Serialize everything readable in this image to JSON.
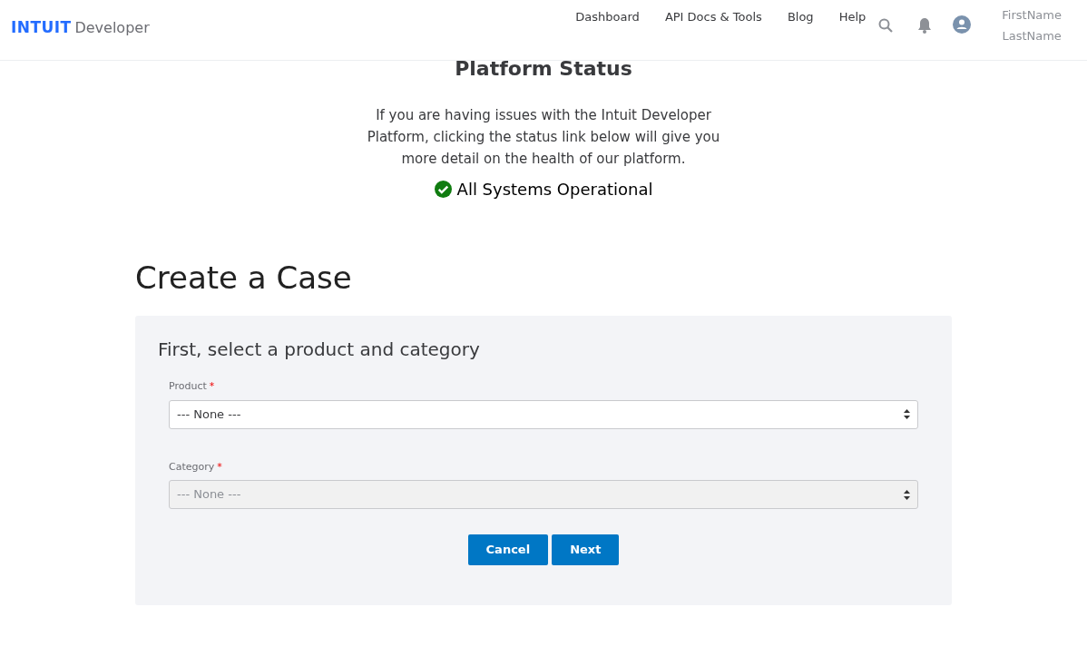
{
  "header": {
    "logo_mark": "INTUIT",
    "logo_text": "Developer",
    "nav": [
      "Dashboard",
      "API Docs & Tools",
      "Blog",
      "Help"
    ],
    "user": {
      "first": "FirstName",
      "last": "LastName"
    }
  },
  "status": {
    "title": "Platform Status",
    "description": "If you are having issues with the Intuit Developer Platform, clicking the status link below will give you more detail on the health of our platform.",
    "link": "All Systems Operational"
  },
  "form": {
    "title": "Create a Case",
    "subtitle": "First, select a product and category",
    "fields": [
      {
        "label": "Product",
        "required_mark": "*",
        "value": "--- None ---",
        "disabled": false
      },
      {
        "label": "Category",
        "required_mark": "*",
        "value": "--- None ---",
        "disabled": true
      }
    ],
    "buttons": [
      "Cancel",
      "Next"
    ]
  }
}
